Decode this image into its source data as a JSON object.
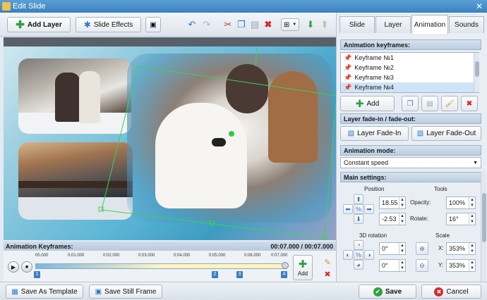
{
  "window": {
    "title": "Edit Slide",
    "close": "✕"
  },
  "toolbar": {
    "add_layer": "Add Layer",
    "slide_effects": "Slide Effects"
  },
  "right_tabs": [
    "Slide",
    "Layer",
    "Animation",
    "Sounds"
  ],
  "active_tab": "Animation",
  "animation_keyframes": {
    "header": "Animation keyframes:",
    "items": [
      "Keyframe №1",
      "Keyframe №2",
      "Keyframe №3",
      "Keyframe №4"
    ],
    "selected_index": 3,
    "add_label": "Add"
  },
  "fade": {
    "header": "Layer fade-in / fade-out:",
    "fade_in": "Layer Fade-In",
    "fade_out": "Layer Fade-Out"
  },
  "mode": {
    "header": "Animation mode:",
    "value": "Constant speed"
  },
  "main_settings": {
    "header": "Main settings:",
    "position_label": "Position",
    "pos_x": "18.55",
    "pos_y": "-2.53",
    "tools_label": "Tools",
    "opacity_label": "Opacity:",
    "opacity": "100%",
    "rotate_label": "Rotate:",
    "rotate": "16°",
    "rotation3d_label": "3D rotation",
    "rot_a": "0°",
    "rot_b": "0°",
    "scale_label": "Scale",
    "scale_x_label": "X:",
    "scale_x": "353%",
    "scale_y_label": "Y:",
    "scale_y": "353%"
  },
  "timeline": {
    "header": "Animation Keyframes:",
    "time": "00:07.000 / 00:07.000",
    "ticks": [
      "00.000",
      "0:01.000",
      "0:02.000",
      "0:03.000",
      "0:04.000",
      "0:05.000",
      "0:06.000",
      "0:07.000"
    ],
    "markers": [
      "1",
      "2",
      "3",
      "4"
    ],
    "add_label": "Add"
  },
  "bottom": {
    "save_template": "Save As Template",
    "save_still": "Save Still Frame",
    "save": "Save",
    "cancel": "Cancel"
  },
  "colors": {
    "accent": "#3b82c0",
    "selection": "#cfe4f6"
  }
}
